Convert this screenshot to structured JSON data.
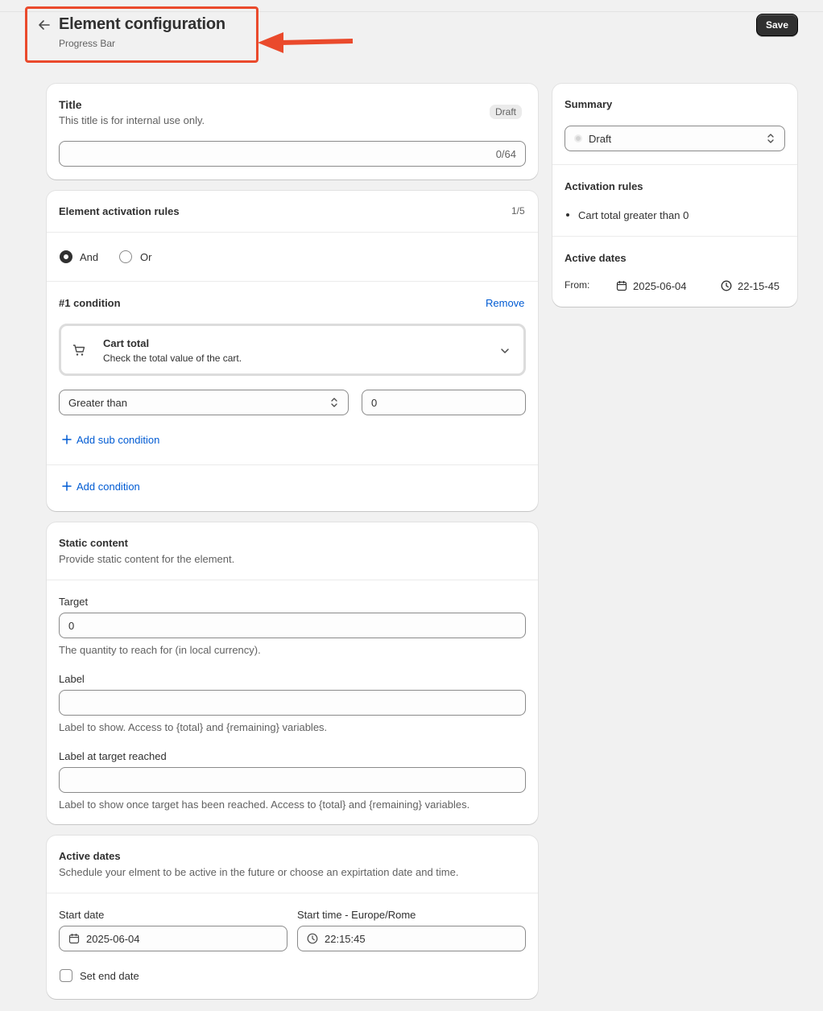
{
  "header": {
    "title": "Element configuration",
    "subtitle": "Progress Bar",
    "save_label": "Save"
  },
  "title_card": {
    "heading": "Title",
    "description": "This title is for internal use only.",
    "status_badge": "Draft",
    "title_value": "",
    "char_count": "0/64"
  },
  "rules_card": {
    "heading": "Element activation rules",
    "count": "1/5",
    "logic_options": [
      {
        "label": "And",
        "selected": true
      },
      {
        "label": "Or",
        "selected": false
      }
    ],
    "condition_heading": "#1 condition",
    "remove_label": "Remove",
    "condition_type_title": "Cart total",
    "condition_type_desc": "Check the total value of the cart.",
    "operator_value": "Greater than",
    "amount_value": "0",
    "add_sub_condition_label": "Add sub condition",
    "add_condition_label": "Add condition"
  },
  "static_card": {
    "heading": "Static content",
    "description": "Provide static content for the element.",
    "target_label": "Target",
    "target_value": "0",
    "target_help": "The quantity to reach for (in local currency).",
    "label_label": "Label",
    "label_value": "",
    "label_help": "Label to show. Access to {total} and {remaining} variables.",
    "reached_label": "Label at target reached",
    "reached_value": "",
    "reached_help": "Label to show once target has been reached. Access to {total} and {remaining} variables."
  },
  "dates_card": {
    "heading": "Active dates",
    "description": "Schedule your elment to be active in the future or choose an expirtation date and time.",
    "start_date_label": "Start date",
    "start_date_value": "2025-06-04",
    "start_time_label": "Start time - Europe/Rome",
    "start_time_value": "22:15:45",
    "set_end_date_label": "Set end date",
    "set_end_date_checked": false
  },
  "summary": {
    "heading": "Summary",
    "status_value": "Draft",
    "activation_heading": "Activation rules",
    "activation_rules": [
      "Cart total greater than 0"
    ],
    "dates_heading": "Active dates",
    "from_label": "From:",
    "from_date": "2025-06-04",
    "from_time": "22-15-45"
  },
  "colors": {
    "annotation": "#ea4a2c",
    "link": "#005bd3",
    "primary_button": "#303030",
    "background": "#f1f1f1"
  },
  "icons": [
    "arrow-left-icon",
    "cart-icon",
    "chevron-down-icon",
    "select-arrows-icon",
    "plus-icon",
    "calendar-icon",
    "clock-icon",
    "status-dot-icon"
  ]
}
